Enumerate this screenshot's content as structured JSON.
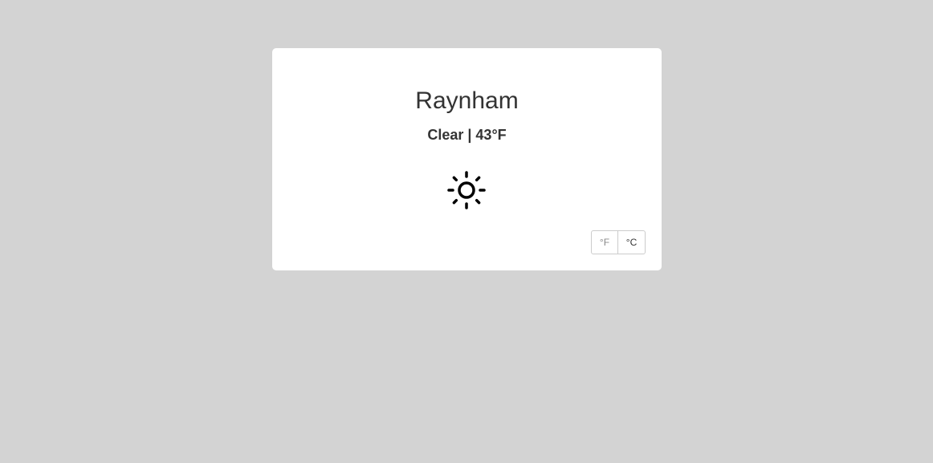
{
  "weather": {
    "city": "Raynham",
    "condition": "Clear",
    "separator": " | ",
    "temperature": "43°F",
    "icon": "sun-icon"
  },
  "unit_toggle": {
    "fahrenheit_label": "°F",
    "celsius_label": "°C",
    "selected": "°F"
  },
  "colors": {
    "page_background": "#d3d3d3",
    "card_background": "#ffffff",
    "text": "#333333",
    "icon": "#000000"
  }
}
